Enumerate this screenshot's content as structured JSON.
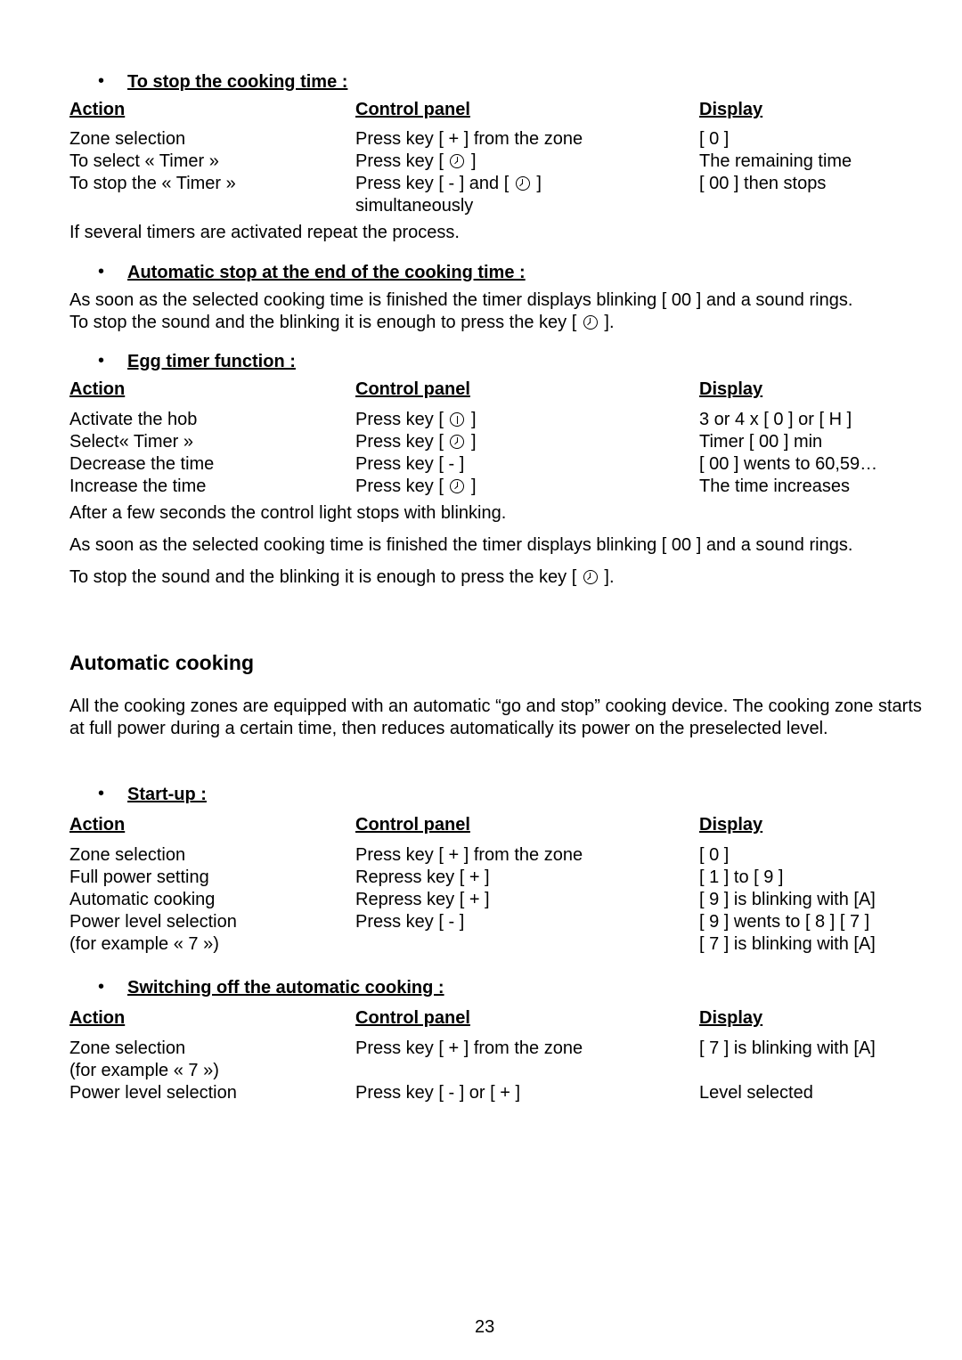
{
  "sections": {
    "stop_cooking": {
      "title": "To stop the cooking time :",
      "headers": {
        "action": "Action",
        "control": "Control panel",
        "display": "Display"
      },
      "rows": [
        {
          "action": "Zone selection",
          "control": "Press key [ + ] from the zone",
          "display": "[ 0 ]"
        },
        {
          "action": "To select « Timer »",
          "control_pre": "Press key [",
          "control_icon": "clock-icon",
          "control_post": "]",
          "display": "The remaining time"
        },
        {
          "action": "To stop the « Timer »",
          "control_pre": "Press key [ - ] and [",
          "control_icon": "clock-icon",
          "control_post": "]",
          "control_line2": "simultaneously",
          "display": "[ 00 ] then stops"
        }
      ],
      "note": "If several timers are activated repeat the process."
    },
    "auto_stop": {
      "title": "Automatic stop at the end of the cooking time :",
      "line1": "As soon as the selected cooking time is finished the timer displays blinking [ 00 ] and a sound rings.",
      "line2_pre": "To stop the sound and the blinking it is enough to press the key [",
      "line2_post": "]."
    },
    "egg_timer": {
      "title": "Egg timer function :",
      "headers": {
        "action": "Action",
        "control": "Control panel",
        "display": "Display"
      },
      "rows": [
        {
          "action": "Activate the hob",
          "control_pre": "Press key [",
          "control_icon": "power-icon",
          "control_post": "]",
          "display": "3 or 4 x [ 0 ] or [ H ]"
        },
        {
          "action": "Select« Timer »",
          "control_pre": "Press key [",
          "control_icon": "clock-icon",
          "control_post": "]",
          "display": "Timer [ 00 ] min"
        },
        {
          "action": "Decrease the time",
          "control": "Press key [ - ]",
          "display": "[ 00 ] wents to 60,59…"
        },
        {
          "action": "Increase the time",
          "control_pre": "Press key [",
          "control_icon": "clock-icon",
          "control_post": "]",
          "display": "The time increases"
        }
      ],
      "note1": "After a few seconds the control light stops with blinking.",
      "note2": "As soon as the selected cooking time is finished the timer displays blinking [ 00 ] and a sound rings.",
      "note3_pre": "To stop the sound and the blinking it is enough to press the key [",
      "note3_post": "]."
    },
    "automatic_cooking": {
      "heading": "Automatic cooking",
      "intro": "All the cooking zones are equipped with an automatic “go and stop” cooking device. The cooking zone starts at full power during a certain time, then reduces automatically its power on the preselected level."
    },
    "startup": {
      "title": "Start-up :",
      "headers": {
        "action": "Action",
        "control": "Control panel",
        "display": "Display"
      },
      "rows": [
        {
          "action": "Zone selection",
          "control": "Press key [ + ] from the zone",
          "display": "[ 0 ]"
        },
        {
          "action": "Full power setting",
          "control": "Repress key [ + ]",
          "display": "[ 1 ] to [ 9 ]"
        },
        {
          "action": "Automatic cooking",
          "control": "Repress key [ + ]",
          "display": "[ 9 ] is blinking with [A]"
        },
        {
          "action": "Power level selection",
          "control": "Press key [ - ]",
          "display": "[ 9 ] wents to [ 8 ] [ 7 ]"
        },
        {
          "action": "(for example « 7 »)",
          "control": "",
          "display": "[ 7 ] is blinking with [A]"
        }
      ]
    },
    "switch_off": {
      "title": "Switching off the automatic cooking :",
      "headers": {
        "action": "Action",
        "control": "Control panel",
        "display": "Display"
      },
      "rows": [
        {
          "action": "Zone selection",
          "control": "Press key [ + ] from the zone",
          "display": "[ 7 ] is blinking with [A]"
        },
        {
          "action": "(for example « 7 »)",
          "control": "",
          "display": ""
        },
        {
          "action": "Power level selection",
          "control": "Press key [ - ] or [ + ]",
          "display": "Level selected"
        }
      ]
    }
  },
  "page_number": "23"
}
